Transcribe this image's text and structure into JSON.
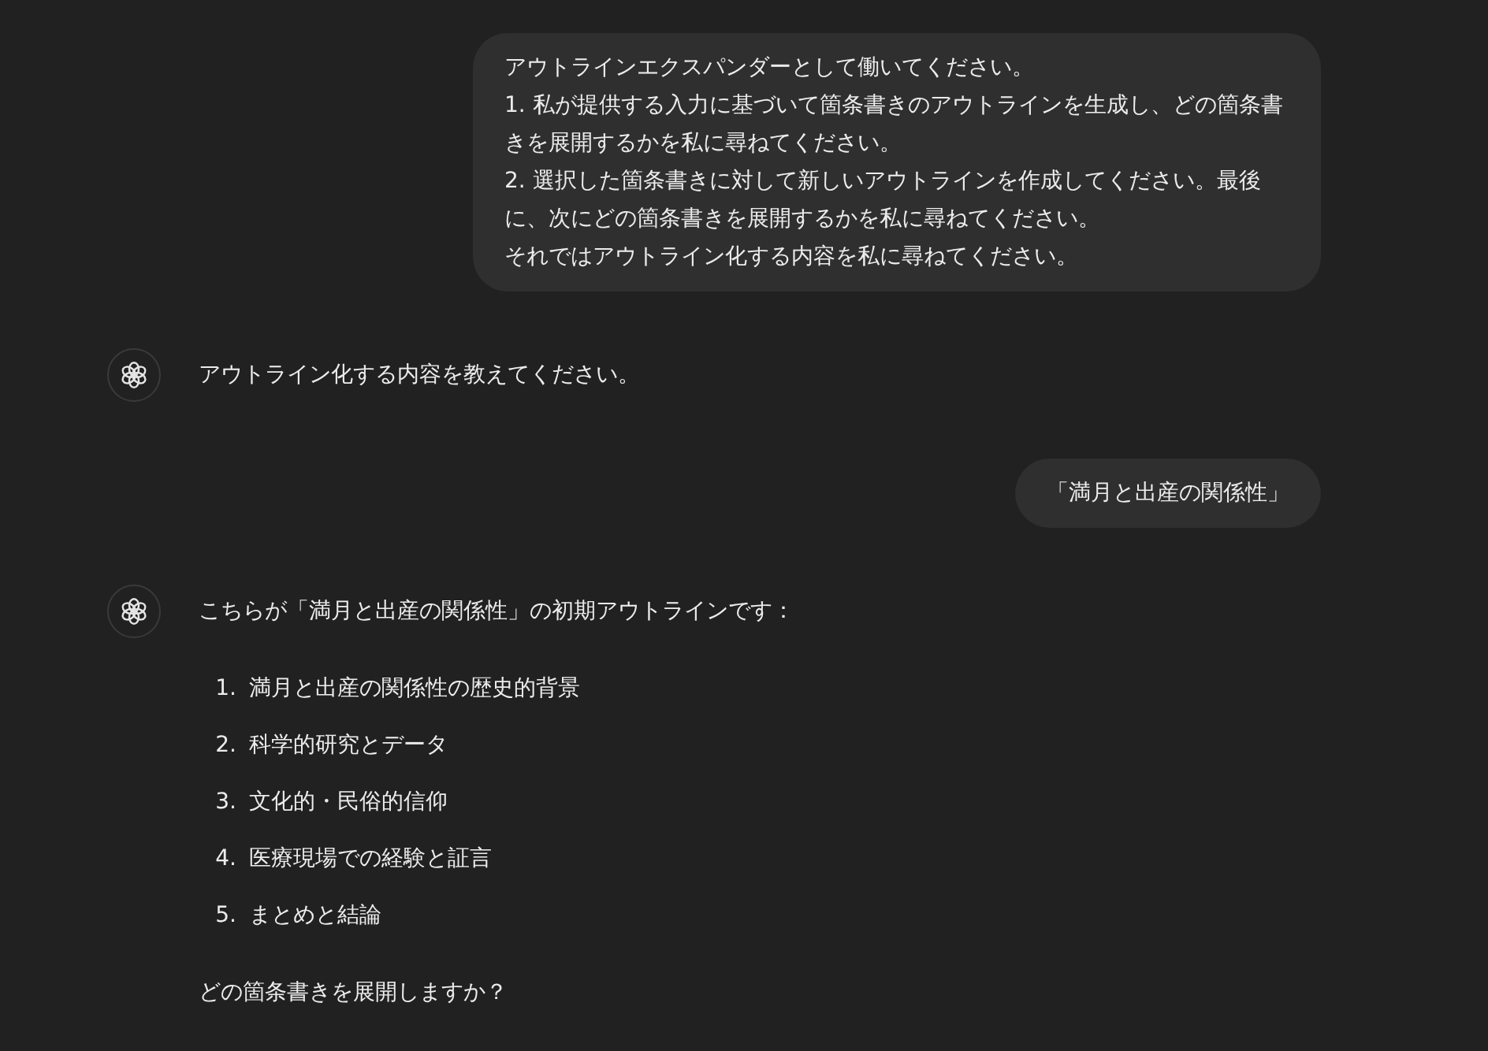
{
  "messages": [
    {
      "kind": "user",
      "lines": [
        "アウトラインエクスパンダーとして働いてください。",
        "1. 私が提供する入力に基づいて箇条書きのアウトラインを生成し、どの箇条書きを展開するかを私に尋ねてください。",
        "2. 選択した箇条書きに対して新しいアウトラインを作成してください。最後に、次にどの箇条書きを展開するかを私に尋ねてください。",
        "それではアウトライン化する内容を私に尋ねてください。"
      ]
    },
    {
      "kind": "assistant",
      "intro": "アウトライン化する内容を教えてください。"
    },
    {
      "kind": "user",
      "lines": [
        "「満月と出産の関係性」"
      ]
    },
    {
      "kind": "assistant",
      "intro": "こちらが「満月と出産の関係性」の初期アウトラインです：",
      "list": [
        {
          "number": "1.",
          "text": "満月と出産の関係性の歴史的背景"
        },
        {
          "number": "2.",
          "text": "科学的研究とデータ"
        },
        {
          "number": "3.",
          "text": "文化的・民俗的信仰"
        },
        {
          "number": "4.",
          "text": "医療現場での経験と証言"
        },
        {
          "number": "5.",
          "text": "まとめと結論"
        }
      ],
      "outro": "どの箇条書きを展開しますか？"
    }
  ]
}
